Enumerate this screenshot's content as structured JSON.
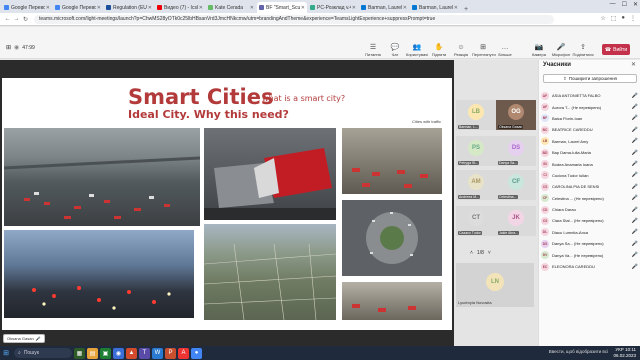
{
  "browser": {
    "tabs": [
      {
        "label": "Google Переводчи",
        "color": "#4285f4",
        "active": false
      },
      {
        "label": "Google Переводчи",
        "color": "#4285f4",
        "active": false
      },
      {
        "label": "Regulation (EU) 20",
        "color": "#1a4f9c",
        "active": false
      },
      {
        "label": "Видео (7) - IcsIma",
        "color": "#e00",
        "active": false
      },
      {
        "label": "Kate Cerada",
        "color": "#6b6",
        "active": false
      },
      {
        "label": "ВF \"Smart_Scuo",
        "color": "#6264a7",
        "active": true
      },
      {
        "label": "PC-Розклад v.4.0",
        "color": "#3a8",
        "active": false
      },
      {
        "label": "Barman, Laurel - Пр",
        "color": "#0078d4",
        "active": false
      },
      {
        "label": "Barman, Laurel - Асу",
        "color": "#0078d4",
        "active": false
      }
    ],
    "url": "teams.microsoft.com/light-meetings/launch?p=ChwMS28yOTk0c25lbHBsanVrd3JmcHNkcmw/utm=brandingAndTheme&experience=TeamsLightExperience+suppressPrompt=true"
  },
  "meeting": {
    "elapsed": "47:99",
    "toolbar": [
      {
        "icon": "☰",
        "label": "Питання",
        "name": "questions"
      },
      {
        "icon": "💬",
        "label": "Чат",
        "name": "chat"
      },
      {
        "icon": "👥",
        "label": "Користувачі",
        "name": "people"
      },
      {
        "icon": "✋",
        "label": "Підняти",
        "name": "raise-hand"
      },
      {
        "icon": "☺",
        "label": "Реакція",
        "name": "react"
      },
      {
        "icon": "⊞",
        "label": "Переглянути",
        "name": "view"
      },
      {
        "icon": "…",
        "label": "Більше",
        "name": "more"
      },
      {
        "icon": "📷",
        "label": "Камера",
        "name": "camera"
      },
      {
        "icon": "🎤",
        "label": "Мікрофон",
        "name": "mic"
      },
      {
        "icon": "⇪",
        "label": "Поділитися",
        "name": "share"
      }
    ],
    "leave_label": "Вийти"
  },
  "slide": {
    "title": "Smart Cities",
    "subtitle": "what is a smart city?",
    "heading": "Ideal City. Why this need?",
    "caption": "Cities with traffic",
    "presenter": "Oksana Gasan"
  },
  "tiles": [
    {
      "initials": "LB",
      "name": "Barman, L...",
      "color": "#fde7b0",
      "fg": "#8a6"
    },
    {
      "initials": "OG",
      "name": "Oksana Gasan",
      "color": "#777",
      "fg": "#fff",
      "photo": true
    },
    {
      "initials": "PS",
      "name": "Petryga St...",
      "color": "#d6e9c6",
      "fg": "#6a8"
    },
    {
      "initials": "DS",
      "name": "Danya Sa...",
      "color": "#e6d0f0",
      "fg": "#a6c"
    },
    {
      "initials": "AM",
      "name": "Andreea M...",
      "color": "#e8e2c8",
      "fg": "#a96"
    },
    {
      "initials": "CF",
      "name": "Celestina...",
      "color": "#cbe6dd",
      "fg": "#598"
    },
    {
      "initials": "CT",
      "name": "Cazacu Tudor",
      "color": "#ddd",
      "fg": "#777"
    },
    {
      "initials": "JK",
      "name": "Jakie Abra...",
      "color": "#f3d6e6",
      "fg": "#a58"
    }
  ],
  "pager": "1/8",
  "big_tile": {
    "initials": "LN",
    "name": "Lyudmyla Novosita"
  },
  "panel": {
    "title": "Учасники",
    "invite_label": "Поширити запрошення",
    "participants": [
      {
        "initials": "AF",
        "name": "ASIA ANTONIETTA FALBO",
        "color": "#f4d5e0"
      },
      {
        "initials": "AF",
        "name": "Aurora T... (Не перевірено)",
        "color": "#f4d5e0"
      },
      {
        "initials": "BF",
        "name": "Baica Florin-Ioan",
        "color": "#dfe6f8"
      },
      {
        "initials": "BC",
        "name": "BEATRICE CAREDDU",
        "color": "#f4d5e0"
      },
      {
        "initials": "LB",
        "name": "Barman, Laurel Amy",
        "color": "#fde7b0"
      },
      {
        "initials": "BD",
        "name": "Bap Dama-Iulia-Maria",
        "color": "#f4d5e0"
      },
      {
        "initials": "BI",
        "name": "Bodea Anamaria Ioana",
        "color": "#f4d5e0"
      },
      {
        "initials": "CI",
        "name": "Cucicna Tudor Iulian",
        "color": "#f4d5e0"
      },
      {
        "initials": "CS",
        "name": "CAROLINA PIA DE SENSI",
        "color": "#f4d5e0"
      },
      {
        "initials": "CF",
        "name": "Celestina ... (Не перевірено)",
        "color": "#d6ead0"
      },
      {
        "initials": "CD",
        "name": "Chiara Darau",
        "color": "#f4d5e0"
      },
      {
        "initials": "CS",
        "name": "Ciara Stal... (Не перевірено)",
        "color": "#f4d5e0"
      },
      {
        "initials": "DL",
        "name": "Diacu Lumnita-Anca",
        "color": "#f4d5e0"
      },
      {
        "initials": "DS",
        "name": "Danya Sa... (Не перевірено)",
        "color": "#e6d0f0"
      },
      {
        "initials": "DV",
        "name": "Danya Va... (Не перевірено)",
        "color": "#d6ead0"
      },
      {
        "initials": "EC",
        "name": "ELEONORA CAREDDU",
        "color": "#f4d5e0"
      }
    ]
  },
  "taskbar": {
    "search_label": "Пошук",
    "tray_left": "Ввести, щоб відобразити всі",
    "time": "10:11",
    "date": "06.02.2023",
    "lang": "УКР"
  }
}
